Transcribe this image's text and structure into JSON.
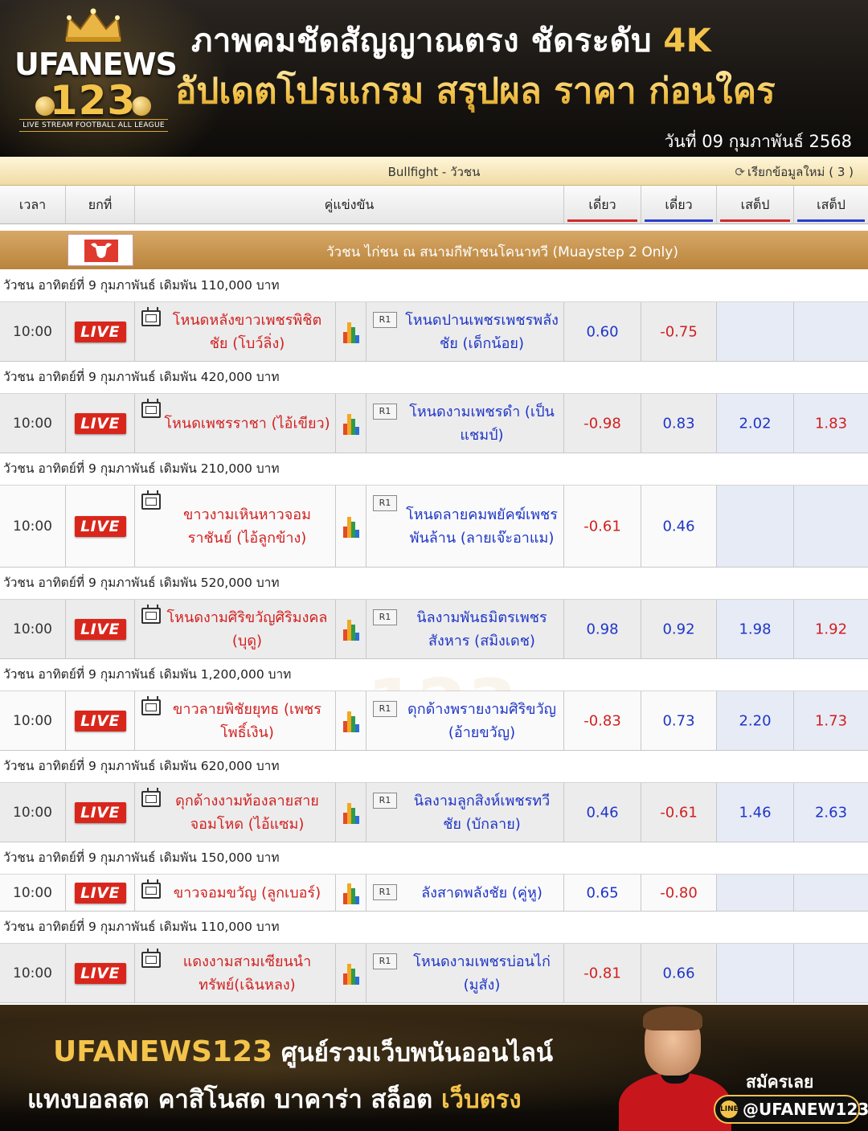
{
  "header": {
    "brand_top": "UFANEWS",
    "brand_num": "123",
    "brand_tagline": "LIVE STREAM FOOTBALL ALL LEAGUE",
    "headline1_main": "ภาพคมชัดสัญญาณตรง ชัดระดับ ",
    "headline1_accent": "4K",
    "headline2": "อัปเดตโปรแกรม สรุปผล ราคา ก่อนใคร",
    "date": "วันที่  09 กุมภาพันธ์ 2568"
  },
  "titlebar": {
    "title": "Bullfight - วัวชน",
    "reload_label": "เรียกข้อมูลใหม่ ( 3 )"
  },
  "columns": {
    "time": "เวลา",
    "round": "ยกที่",
    "match": "คู่แข่งขัน",
    "odd1": "เดี่ยว",
    "odd2": "เดี่ยว",
    "odd3": "เสต็ป",
    "odd4": "เสต็ป"
  },
  "league": {
    "title": "วัวชน ไก่ชน ณ สนามกีฬาชนโคนาทวี (Muaystep 2 Only)"
  },
  "live_label": "LIVE",
  "r1_label": "R1",
  "matches": [
    {
      "subhead": "วัวชน อาทิตย์ที่ 9 กุมภาพันธ์ เดิมพัน 110,000 บาท",
      "time": "10:00",
      "home": "โหนดหลังขาวเพชรพิชิตชัย (โบว์ลิ่ง)",
      "away": "โหนดปานเพชรเพชรพลังชัย (เด็กน้อย)",
      "odd1": "0.60",
      "odd2": "-0.75",
      "odd3": "",
      "odd4": ""
    },
    {
      "subhead": "วัวชน อาทิตย์ที่ 9 กุมภาพันธ์ เดิมพัน 420,000 บาท",
      "time": "10:00",
      "home": "โหนดเพชรราชา (ไอ้เขียว)",
      "away": "โหนดงามเพชรดำ (เป็นแชมป์)",
      "odd1": "-0.98",
      "odd2": "0.83",
      "odd3": "2.02",
      "odd4": "1.83"
    },
    {
      "subhead": "วัวชน อาทิตย์ที่ 9 กุมภาพันธ์ เดิมพัน 210,000 บาท",
      "time": "10:00",
      "home": "ขาวงามเหินหาวจอมราชันย์ (ไอ้ลูกข้าง)",
      "away": "โหนดลายคมพยัคฆ์เพชรพันล้าน (ลายเจ๊ะอาแม)",
      "odd1": "-0.61",
      "odd2": "0.46",
      "odd3": "",
      "odd4": ""
    },
    {
      "subhead": "วัวชน อาทิตย์ที่ 9 กุมภาพันธ์ เดิมพัน 520,000 บาท",
      "time": "10:00",
      "home": "โหนดงามศิริขวัญศิริมงคล (บุดู)",
      "away": "นิลงามพันธมิตรเพชรสังหาร (สมิงเดช)",
      "odd1": "0.98",
      "odd2": "0.92",
      "odd3": "1.98",
      "odd4": "1.92"
    },
    {
      "subhead": "วัวชน อาทิตย์ที่ 9 กุมภาพันธ์ เดิมพัน 1,200,000 บาท",
      "time": "10:00",
      "home": "ขาวลายพิชัยยุทธ (เพชรโพธิ์เงิน)",
      "away": "ดุกด้างพรายงามศิริขวัญ (อ้ายขวัญ)",
      "odd1": "-0.83",
      "odd2": "0.73",
      "odd3": "2.20",
      "odd4": "1.73"
    },
    {
      "subhead": "วัวชน อาทิตย์ที่ 9 กุมภาพันธ์ เดิมพัน 620,000 บาท",
      "time": "10:00",
      "home": "ดุกด้างงามท้องลายสายจอมโหด (ไอ้แซม)",
      "away": "นิลงามลูกสิงห์เพชรทวีชัย (บักลาย)",
      "odd1": "0.46",
      "odd2": "-0.61",
      "odd3": "1.46",
      "odd4": "2.63"
    },
    {
      "subhead": "วัวชน อาทิตย์ที่ 9 กุมภาพันธ์ เดิมพัน 150,000 บาท",
      "time": "10:00",
      "home": "ขาวจอมขวัญ (ลูกเบอร์)",
      "away": "ลังสาดพลังชัย (คู่หู)",
      "odd1": "0.65",
      "odd2": "-0.80",
      "odd3": "",
      "odd4": ""
    },
    {
      "subhead": "วัวชน อาทิตย์ที่ 9 กุมภาพันธ์ เดิมพัน 110,000 บาท",
      "time": "10:00",
      "home": "แดงงามสามเซียนนำทรัพย์(เฉินหลง)",
      "away": "โหนดงามเพชรบ่อนไก่ (มูสัง)",
      "odd1": "-0.81",
      "odd2": "0.66",
      "odd3": "",
      "odd4": ""
    }
  ],
  "footer": {
    "brand": "UFANEWS123",
    "line1_rest": " ศูนย์รวมเว็บพนันออนไลน์",
    "line2_main": "แทงบอลสด คาสิโนสด บาคาร่า สล็อต ",
    "line2_gold": "เว็บตรง",
    "signup": "สมัครเลย",
    "line_id": "@UFANEW123",
    "line_badge": "LINE"
  },
  "colors": {
    "positive_odd": "#1e35c8",
    "negative_odd": "#d21f1f",
    "home_team": "#d21f1f",
    "away_team": "#1e35c8",
    "live": "#d9261c",
    "gold": "#f3c34a"
  },
  "icons": [
    "crown-icon",
    "tv-icon",
    "chart-icon",
    "refresh-icon",
    "bull-flag-icon",
    "line-icon"
  ]
}
